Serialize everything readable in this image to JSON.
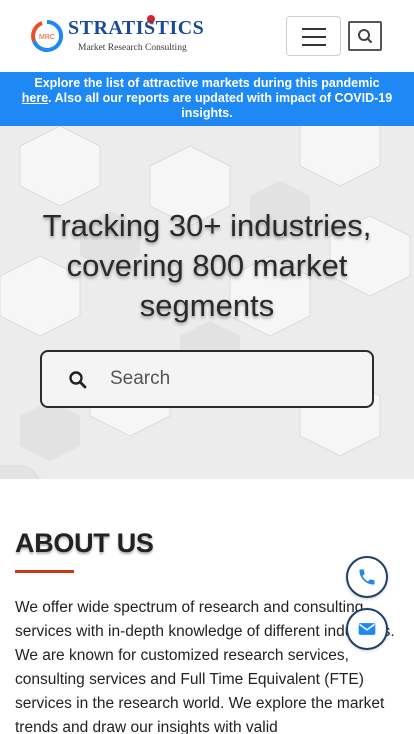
{
  "header": {
    "logo": {
      "title": "STRATISTICS",
      "subtitle": "Market Research Consulting",
      "emblem_text": "MRC"
    },
    "menu_icon": "hamburger-icon",
    "search_icon": "search-icon"
  },
  "banner": {
    "text_before": "Explore the list of attractive markets during this pandemic ",
    "link_text": "here",
    "text_after": ". Also all our reports are updated with impact of COVID-19 insights.",
    "color": "#1e88f5"
  },
  "hero": {
    "title": "Tracking 30+ industries, covering 800 market segments",
    "search": {
      "placeholder": "Search",
      "value": ""
    },
    "side_tab_icon": "chevron-right-icon"
  },
  "about": {
    "heading": "ABOUT US",
    "accent_color": "#c83a1a",
    "body": "We offer wide spectrum of research and consulting services with in-depth knowledge of different industries. We are known for customized research services, consulting services and Full Time Equivalent (FTE) services in the research world. We explore the market trends and draw our insights with valid"
  },
  "floating": {
    "phone_icon": "phone-icon",
    "mail_icon": "mail-icon"
  }
}
